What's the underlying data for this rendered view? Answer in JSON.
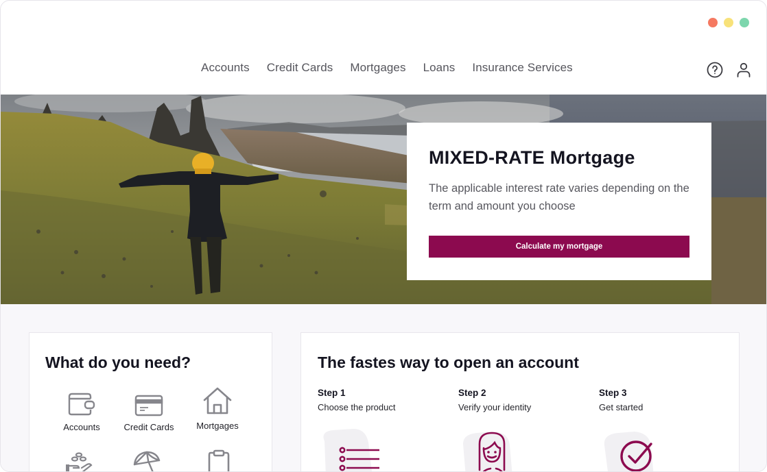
{
  "window": {
    "dots": [
      {
        "name": "close-dot",
        "color": "#f57961"
      },
      {
        "name": "minimize-dot",
        "color": "#f8e27a"
      },
      {
        "name": "maximize-dot",
        "color": "#7dd6ad"
      }
    ]
  },
  "nav": {
    "links": [
      "Accounts",
      "Credit Cards",
      "Mortgages",
      "Loans",
      "Insurance Services"
    ],
    "icons": [
      "help-icon",
      "user-icon"
    ]
  },
  "hero": {
    "image_description": "Hiker with yellow hat and arms outstretched on grassy hillside facing rock pinnacles and lochs",
    "title": "MIXED-RATE Mortgage",
    "description": "The applicable interest rate varies depending on the term and amount you choose",
    "cta_label": "Calculate my mortgage"
  },
  "needs": {
    "title": "What do you need?",
    "items": [
      {
        "label": "Accounts",
        "icon": "wallet-icon"
      },
      {
        "label": "Credit Cards",
        "icon": "credit-card-icon"
      },
      {
        "label": "Mortgages",
        "icon": "house-icon"
      },
      {
        "label": "",
        "icon": "hand-coins-icon"
      },
      {
        "label": "",
        "icon": "umbrella-icon"
      },
      {
        "label": "",
        "icon": "clipboard-icon"
      }
    ]
  },
  "steps": {
    "title": "The fastes way to open an account",
    "items": [
      {
        "title": "Step 1",
        "description": "Choose the product",
        "icon": "list-icon"
      },
      {
        "title": "Step 2",
        "description": "Verify your identity",
        "icon": "person-icon"
      },
      {
        "title": "Step 3",
        "description": "Get started",
        "icon": "check-circle-icon"
      }
    ]
  },
  "colors": {
    "accent": "#8c0a4f",
    "icon_gray": "#86868c",
    "panel_bg": "#f8f7fa"
  }
}
